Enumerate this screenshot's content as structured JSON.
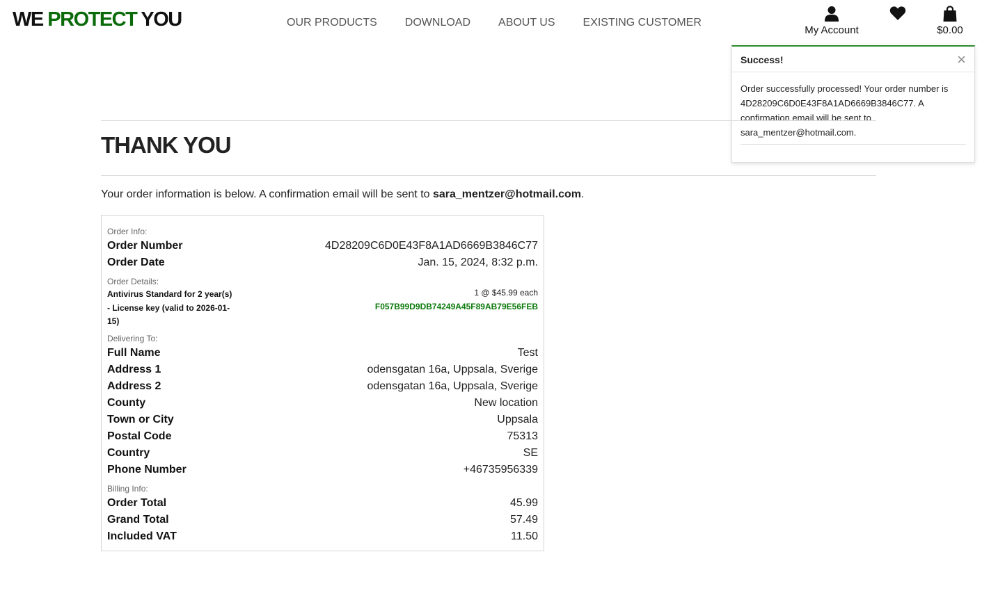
{
  "header": {
    "logo": {
      "part1": "WE ",
      "part2": "PROTECT",
      "part3": " YOU"
    },
    "nav": [
      "OUR PRODUCTS",
      "DOWNLOAD",
      "ABOUT US",
      "EXISTING CUSTOMER"
    ],
    "account_label": "My Account",
    "bag_total": "$0.00"
  },
  "toast": {
    "title": "Success!",
    "message": "Order successfully processed! Your order number is 4D28209C6D0E43F8A1AD6669B3846C77. A confirmation email will be sent to sara_mentzer@hotmail.com."
  },
  "page": {
    "title": "THANK YOU",
    "intro_text": "Your order information is below. A confirmation email will be sent to ",
    "email": "sara_mentzer@hotmail.com",
    "intro_end": "."
  },
  "order": {
    "sections": {
      "order_info": "Order Info:",
      "order_details": "Order Details:",
      "delivering_to": "Delivering To:",
      "billing_info": "Billing Info:"
    },
    "info": [
      {
        "label": "Order Number",
        "value": "4D28209C6D0E43F8A1AD6669B3846C77"
      },
      {
        "label": "Order Date",
        "value": "Jan. 15, 2024, 8:32 p.m."
      }
    ],
    "item": {
      "name": "Antivirus Standard for 2 year(s) - License key (valid to 2026-01-15)",
      "qty": "1 @ $45.99 each",
      "license_key": "F057B99D9DB74249A45F89AB79E56FEB"
    },
    "delivery": [
      {
        "label": "Full Name",
        "value": "Test"
      },
      {
        "label": "Address 1",
        "value": "odensgatan 16a, Uppsala, Sverige"
      },
      {
        "label": "Address 2",
        "value": "odensgatan 16a, Uppsala, Sverige"
      },
      {
        "label": "County",
        "value": "New location"
      },
      {
        "label": "Town or City",
        "value": "Uppsala"
      },
      {
        "label": "Postal Code",
        "value": "75313"
      },
      {
        "label": "Country",
        "value": "SE"
      },
      {
        "label": "Phone Number",
        "value": "+46735956339"
      }
    ],
    "billing": [
      {
        "label": "Order Total",
        "value": "45.99"
      },
      {
        "label": "Grand Total",
        "value": "57.49"
      },
      {
        "label": "Included VAT",
        "value": "11.50"
      }
    ]
  }
}
